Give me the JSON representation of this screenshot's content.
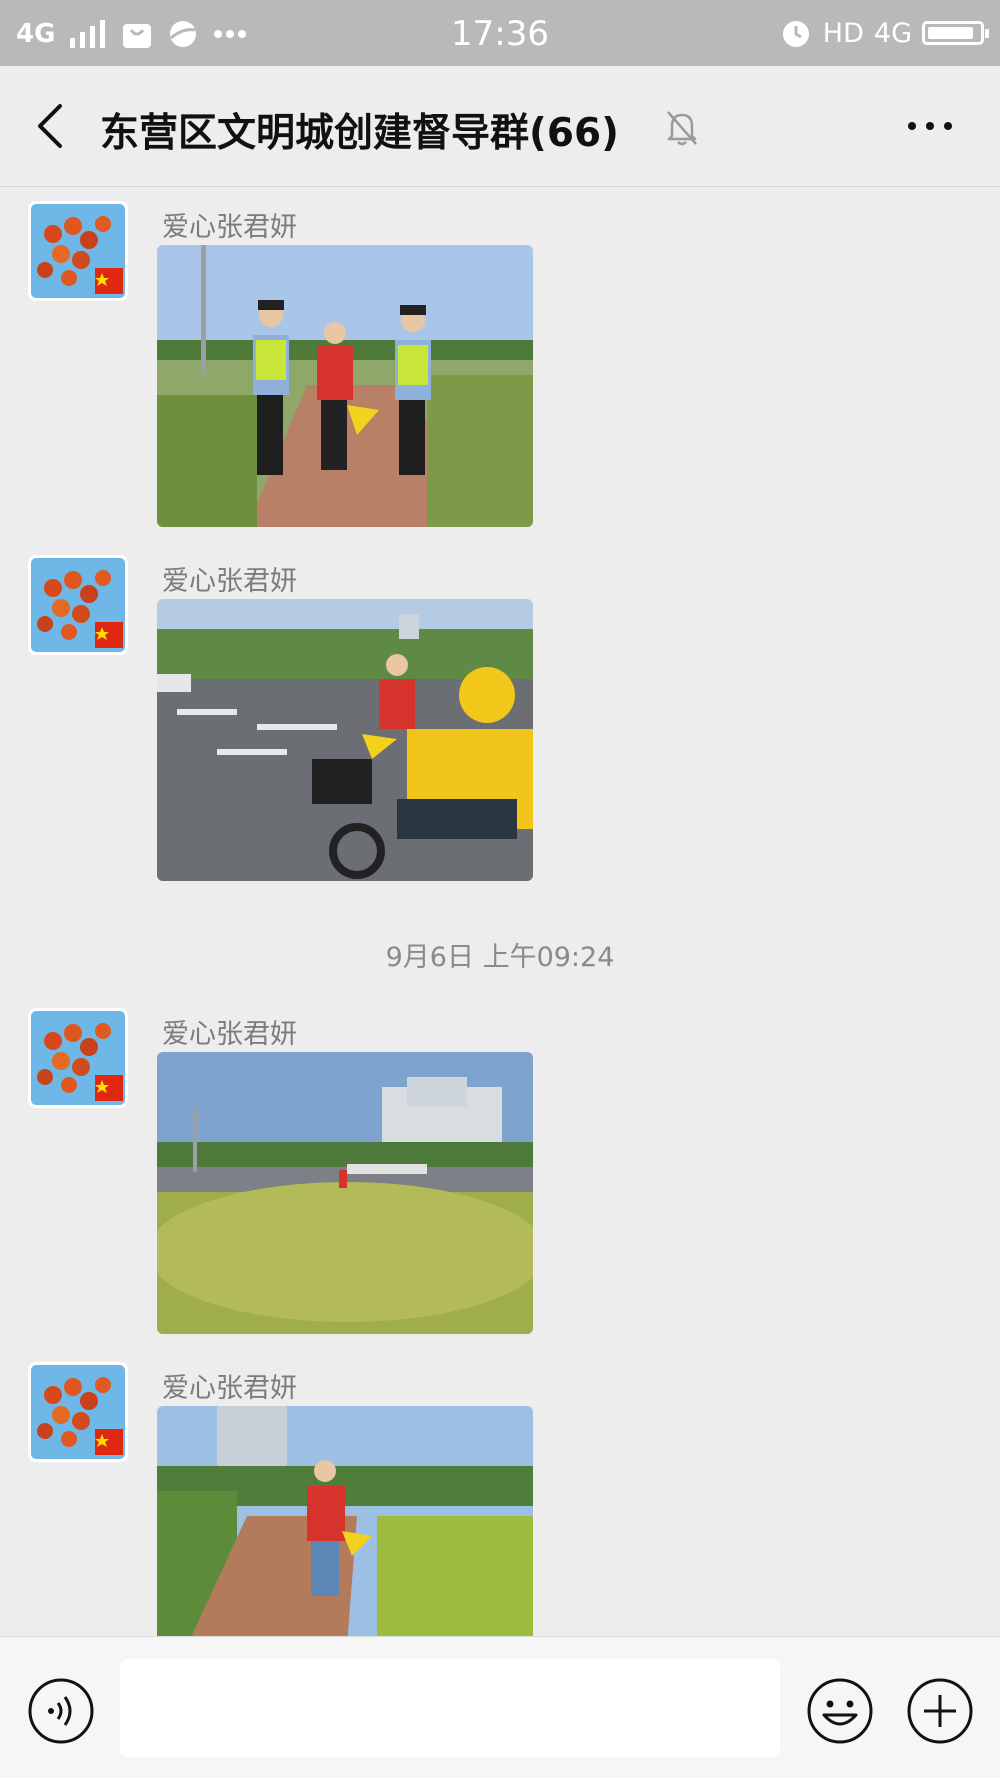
{
  "status_bar": {
    "network_left": "4G",
    "time": "17:36",
    "hd_label": "HD",
    "network_right": "4G",
    "battery_level_percent": 90
  },
  "header": {
    "title": "东营区文明城创建督导群(66)"
  },
  "messages": [
    {
      "sender": "爱心张君妍",
      "photo": "police-and-volunteer-on-sidewalk"
    },
    {
      "sender": "爱心张君妍",
      "photo": "volunteer-and-delivery-rider"
    },
    {
      "sender": "爱心张君妍",
      "photo": "intersection-with-hedges"
    },
    {
      "sender": "爱心张君妍",
      "photo": "volunteer-on-brick-path"
    }
  ],
  "timestamp": "9月6日 上午09:24",
  "colors": {
    "status_bar_bg": "#b9b9b9",
    "chat_bg": "#ededed",
    "input_bar_bg": "#f6f6f6"
  },
  "icons": {
    "back": "chevron-left-icon",
    "mute": "bell-off-icon",
    "more": "more-dots-icon",
    "voice": "voice-icon",
    "emoji": "emoji-icon",
    "plus": "plus-icon"
  }
}
